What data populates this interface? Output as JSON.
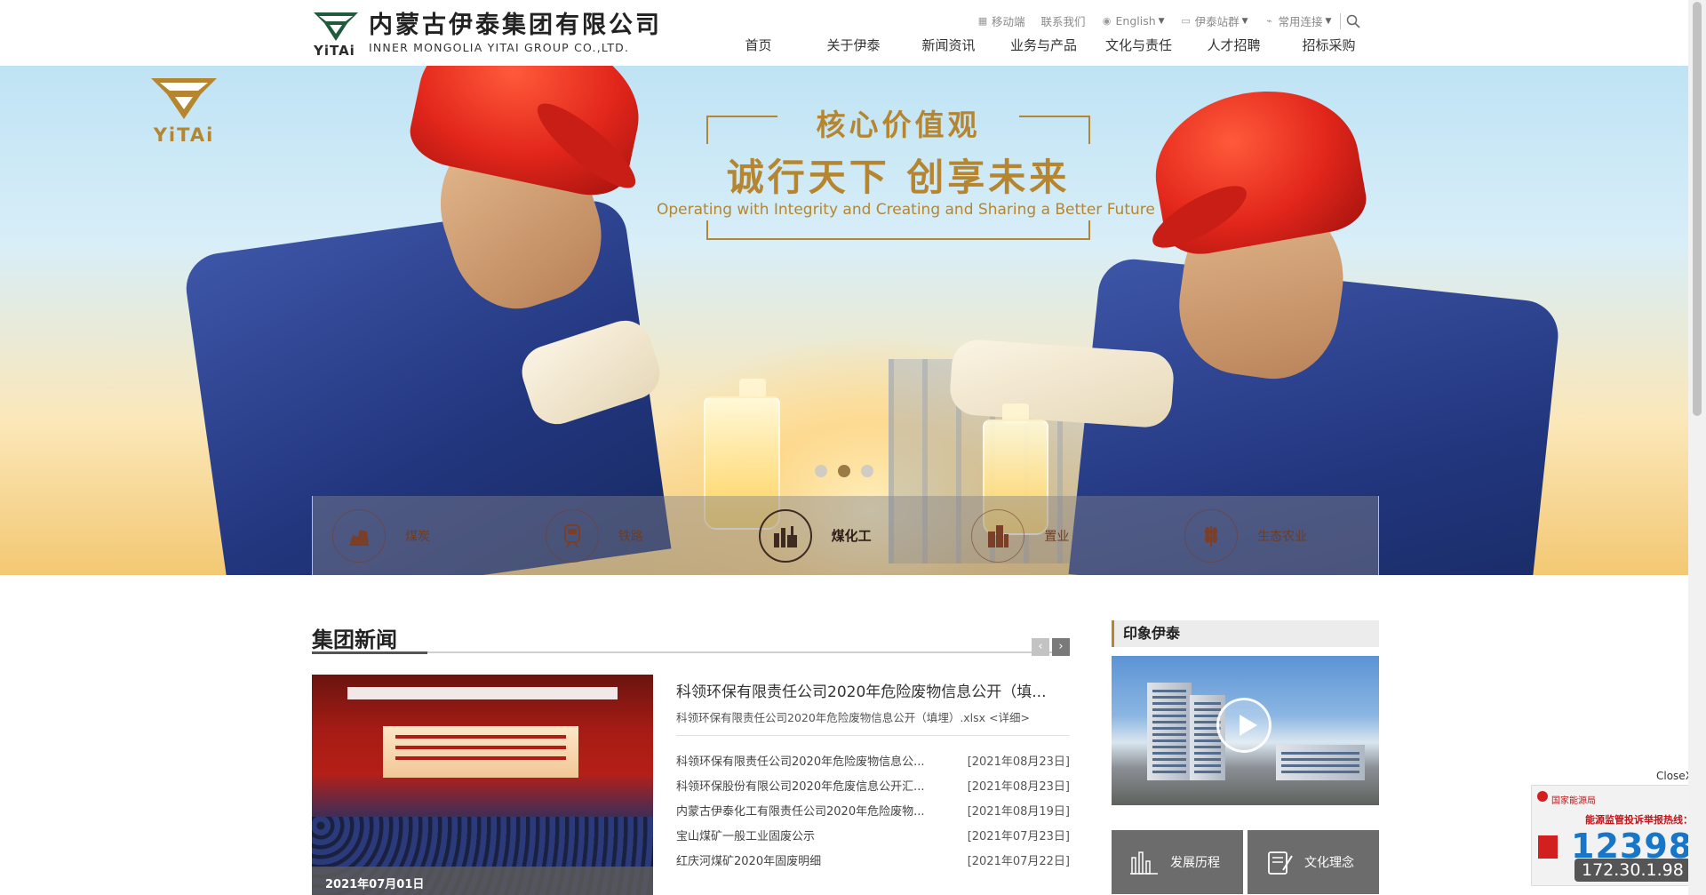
{
  "header": {
    "logo": {
      "cn": "内蒙古伊泰集团有限公司",
      "en": "INNER MONGOLIA YITAI GROUP CO.,LTD.",
      "mark_text": "YiTAi"
    },
    "utility": [
      {
        "label": "移动端",
        "icon": "mobile-icon"
      },
      {
        "label": "联系我们",
        "icon": ""
      },
      {
        "label": "English",
        "icon": "globe-icon",
        "dropdown": true
      },
      {
        "label": "伊泰站群",
        "icon": "monitor-icon",
        "dropdown": true
      },
      {
        "label": "常用连接",
        "icon": "link-icon",
        "dropdown": true
      }
    ],
    "nav": [
      "首页",
      "关于伊泰",
      "新闻资讯",
      "业务与产品",
      "文化与责任",
      "人才招聘",
      "招标采购"
    ]
  },
  "banner": {
    "logo_text": "YiTAi",
    "slogan_title": "核心价值观",
    "slogan_main": "诚行天下 创享未来",
    "slogan_en": "Operating with Integrity and Creating and Sharing a Better Future",
    "slides": 3,
    "active_slide": 2,
    "businesses": [
      {
        "label": "煤炭",
        "icon": "coal-icon",
        "active": false
      },
      {
        "label": "铁路",
        "icon": "train-icon",
        "active": false
      },
      {
        "label": "煤化工",
        "icon": "chemical-plant-icon",
        "active": true
      },
      {
        "label": "置业",
        "icon": "buildings-icon",
        "active": false
      },
      {
        "label": "生态农业",
        "icon": "wheat-icon",
        "active": false
      }
    ]
  },
  "news": {
    "title": "集团新闻",
    "prev": "‹",
    "next": "›",
    "photo_date": "2021年07月01日",
    "feature": {
      "title": "科领环保有限责任公司2020年危险废物信息公开（填...",
      "desc": "科领环保有限责任公司2020年危险废物信息公开（填埋）.xlsx",
      "more": "<详细>"
    },
    "items": [
      {
        "title": "科领环保有限责任公司2020年危险废物信息公...",
        "date": "[2021年08月23日]"
      },
      {
        "title": "科领环保股份有限公司2020年危废信息公开汇...",
        "date": "[2021年08月23日]"
      },
      {
        "title": "内蒙古伊泰化工有限责任公司2020年危险废物...",
        "date": "[2021年08月19日]"
      },
      {
        "title": "宝山煤矿一般工业固废公示",
        "date": "[2021年07月23日]"
      },
      {
        "title": "红庆河煤矿2020年固废明细",
        "date": "[2021年07月22日]"
      }
    ]
  },
  "side": {
    "title": "印象伊泰",
    "tiles": [
      {
        "label": "发展历程",
        "icon": "bar-chart-icon"
      },
      {
        "label": "文化理念",
        "icon": "notebook-icon"
      }
    ]
  },
  "float_ad": {
    "close": "CloseX",
    "org": "国家能源局",
    "hotline_label": "能源监管投诉举报热线：",
    "number": "12398",
    "ip": "172.30.1.98"
  },
  "colors": {
    "gold": "#b5862f",
    "nav_text": "#333333",
    "utility_text": "#8a8a8a",
    "helmet_red": "#e2261b",
    "uniform_blue": "#2a3f8f",
    "tile_gray": "#6c6c6c",
    "hotline_blue": "#1876c8"
  }
}
